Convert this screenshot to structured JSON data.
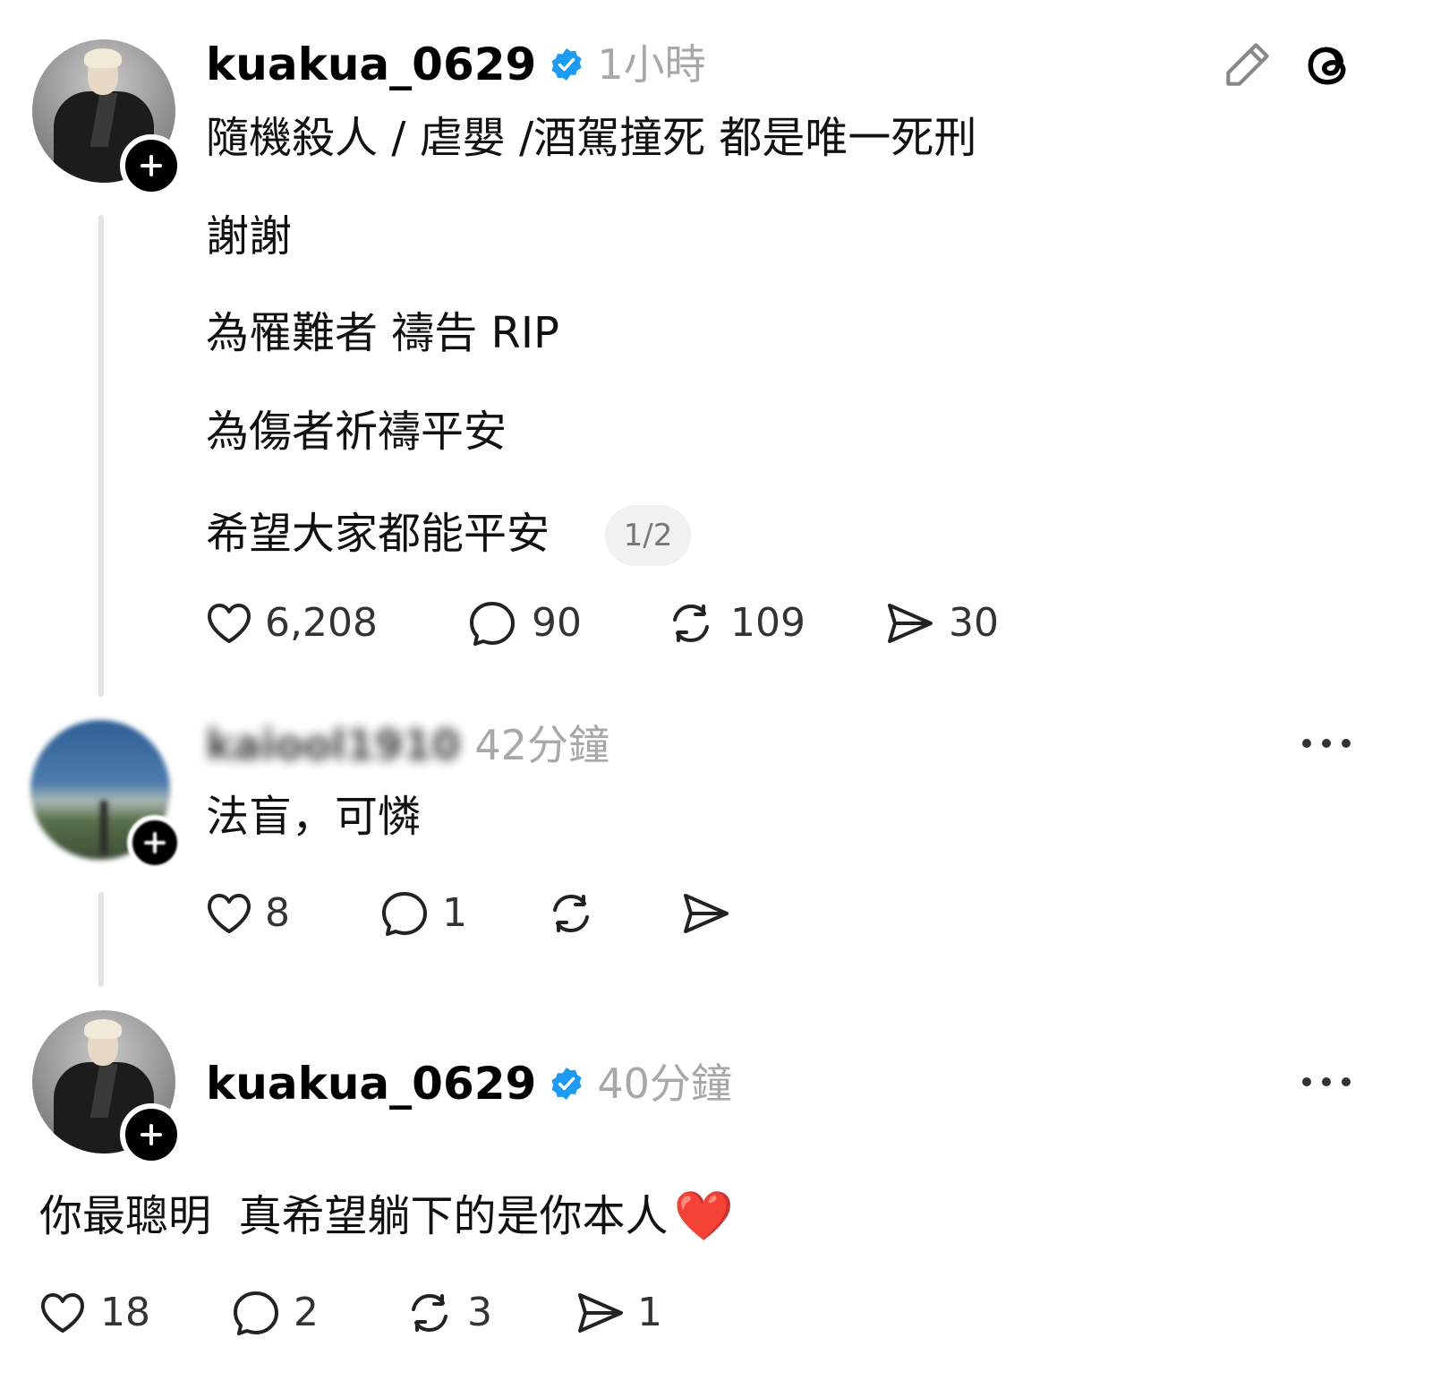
{
  "post": {
    "username": "kuakua_0629",
    "time": "1小時",
    "lines": [
      "隨機殺人 / 虐嬰 /酒駕撞死 都是唯一死刑",
      "謝謝",
      "為罹難者 禱告 RIP",
      "為傷者祈禱平安",
      "希望大家都能平安"
    ],
    "pager": "1/2",
    "likes": "6,208",
    "comments": "90",
    "reposts": "109",
    "shares": "30"
  },
  "reply": {
    "username": "kaiool1910",
    "time": "42分鐘",
    "text": "法盲，可憐",
    "likes": "8",
    "comments": "1"
  },
  "reply2": {
    "username": "kuakua_0629",
    "time": "40分鐘",
    "text": "你最聰明  真希望躺下的是你本人",
    "emoji": "❤️",
    "likes": "18",
    "comments": "2",
    "reposts": "3",
    "shares": "1"
  },
  "colors": {
    "verified": "#1d9bf0",
    "muted": "#a8a8a8",
    "line": "#e4e4e4"
  },
  "icons": [
    "edit-icon",
    "threads-logo-icon",
    "heart-icon",
    "comment-icon",
    "repost-icon",
    "share-icon",
    "more-icon",
    "plus-icon",
    "verified-icon"
  ]
}
